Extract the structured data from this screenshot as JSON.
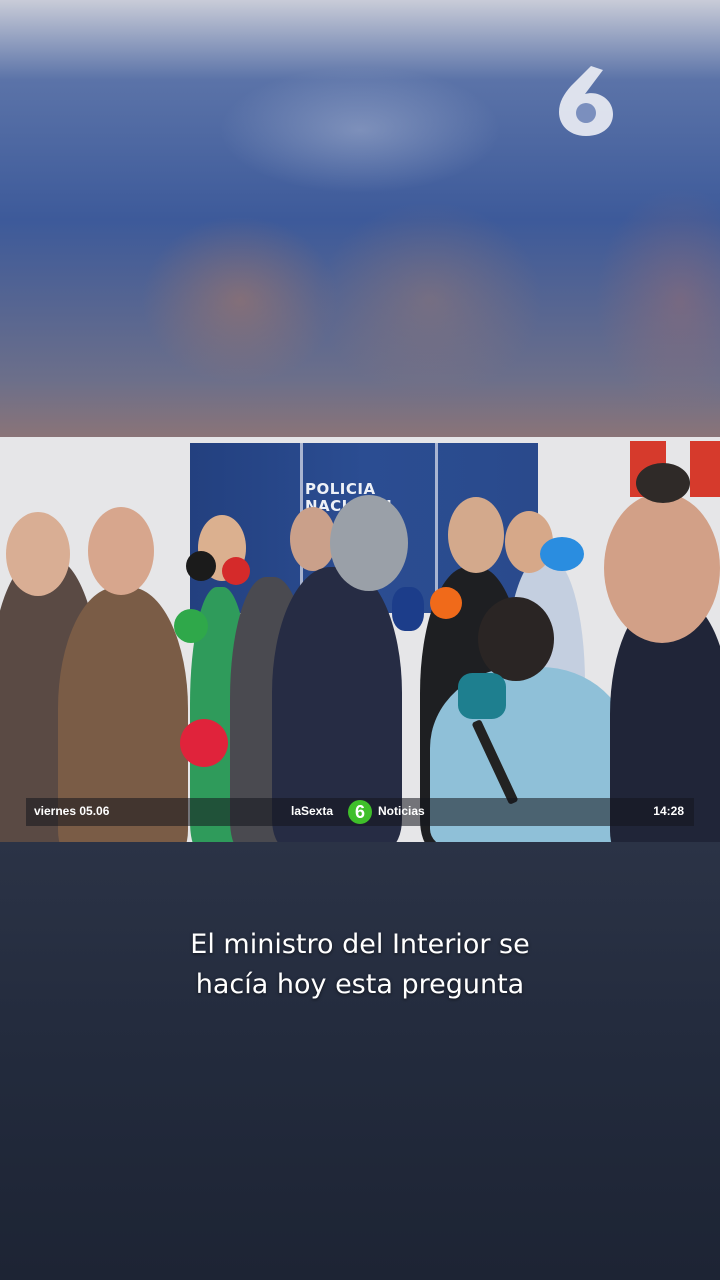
{
  "channel": {
    "logo_icon": "lasexta-6-icon"
  },
  "banner": {
    "line1": "POLICIA",
    "line2": "NACIONAL"
  },
  "ticker": {
    "date": "viernes 05.06",
    "brand": "laSexta",
    "logo_glyph": "6",
    "section": "Noticias",
    "time": "14:28"
  },
  "caption": {
    "line1": "El ministro del Interior se",
    "line2": "hacía hoy esta pregunta"
  },
  "colors": {
    "brand_green": "#3fbf2a",
    "police_blue": "#2b4d92"
  }
}
